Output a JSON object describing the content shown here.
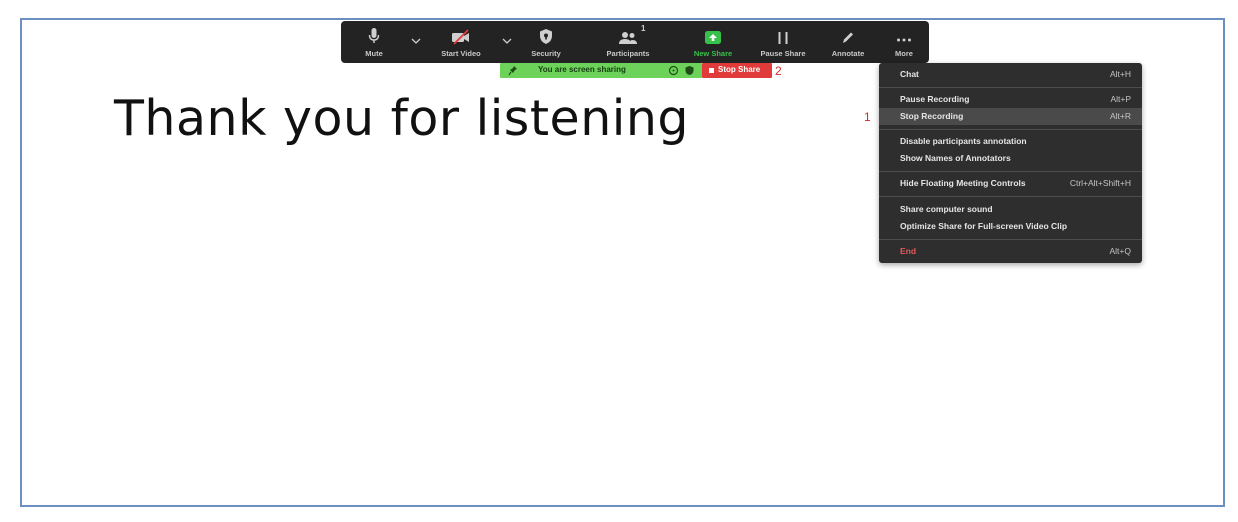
{
  "slide": {
    "title": "Thank you for listening"
  },
  "toolbar": {
    "mute": "Mute",
    "start_video": "Start Video",
    "security": "Security",
    "participants": "Participants",
    "participants_count": "1",
    "new_share": "New Share",
    "pause_share": "Pause Share",
    "annotate": "Annotate",
    "more": "More"
  },
  "sharing_bar": {
    "status": "You are screen sharing",
    "stop_share": "Stop Share"
  },
  "annotations": {
    "marker_1": "1",
    "marker_2": "2"
  },
  "more_menu": {
    "items": [
      {
        "label": "Chat",
        "shortcut": "Alt+H"
      },
      {
        "label": "Pause Recording",
        "shortcut": "Alt+P"
      },
      {
        "label": "Stop Recording",
        "shortcut": "Alt+R"
      },
      {
        "label": "Disable participants annotation",
        "shortcut": ""
      },
      {
        "label": "Show Names of Annotators",
        "shortcut": ""
      },
      {
        "label": "Hide Floating Meeting Controls",
        "shortcut": "Ctrl+Alt+Shift+H"
      },
      {
        "label": "Share computer sound",
        "shortcut": ""
      },
      {
        "label": "Optimize Share for Full-screen Video Clip",
        "shortcut": ""
      },
      {
        "label": "End",
        "shortcut": "Alt+Q"
      }
    ]
  },
  "colors": {
    "toolbar_bg": "#232323",
    "new_share_green": "#37c14a",
    "sharing_bar_green": "#6dd25a",
    "stop_share_red": "#e03a3a",
    "menu_bg": "#2e2e2e",
    "menu_highlight": "#4a4a4a",
    "annotation_red": "#d42a2a",
    "frame_border": "#6a8fc0"
  },
  "icons": [
    "microphone-icon",
    "video-off-icon",
    "shield-icon",
    "participants-icon",
    "share-up-arrow-icon",
    "pause-icon",
    "pencil-icon",
    "ellipsis-icon",
    "pin-icon",
    "chevron-down-icon"
  ]
}
